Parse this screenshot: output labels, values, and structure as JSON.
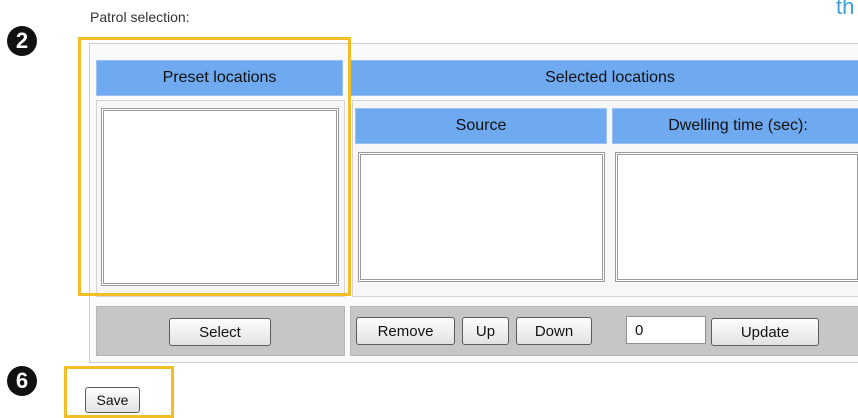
{
  "header": {
    "title": "Patrol selection:",
    "clipped_text": "th"
  },
  "steps": {
    "first": "2",
    "second": "6"
  },
  "table": {
    "preset_header": "Preset locations",
    "selected_header": "Selected locations",
    "source_header": "Source",
    "dwell_header": "Dwelling time (sec):"
  },
  "buttons": {
    "select": "Select",
    "remove": "Remove",
    "up": "Up",
    "down": "Down",
    "update": "Update",
    "save": "Save"
  },
  "dwell_input": {
    "value": "0"
  },
  "colors": {
    "header_blue": "#6fa9f0",
    "highlight": "#f2be24",
    "bar_gray": "#c6c6c6"
  }
}
